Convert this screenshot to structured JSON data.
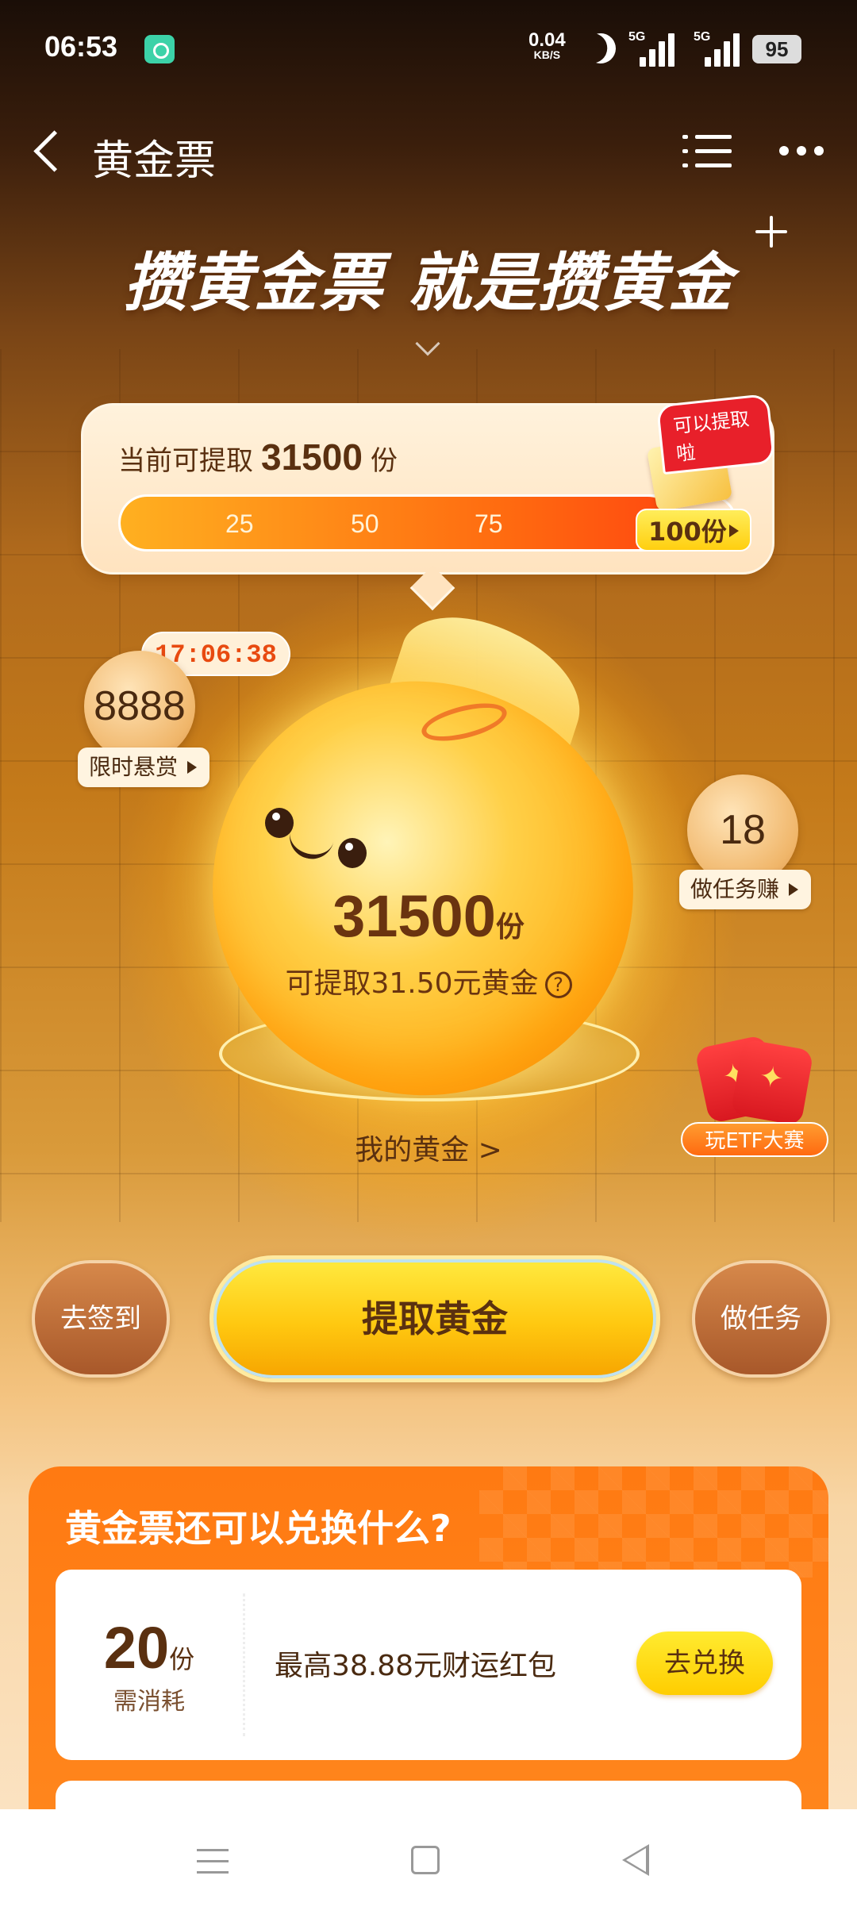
{
  "status_bar": {
    "time": "06:53",
    "net_speed": "0.04",
    "net_unit": "KB/S",
    "signal1": "5G",
    "signal2": "5G",
    "battery": "95"
  },
  "header": {
    "title": "黄金票"
  },
  "slogan": "攒黄金票 就是攒黄金",
  "progress": {
    "label_prefix": "当前可提取",
    "amount": "31500",
    "label_suffix": "份",
    "ticks": [
      "25",
      "50",
      "75"
    ],
    "target_label": "100份",
    "withdraw_tag": "可以提取啦",
    "fill_fraction": 0.9
  },
  "bag": {
    "amount": "31500",
    "unit": "份",
    "sub_text": "可提取31.50元黄金",
    "help_icon": "question-circle-icon",
    "my_gold": "我的黄金 >"
  },
  "limited": {
    "timer": "17:06:38",
    "value": "8888",
    "label": "限时悬赏"
  },
  "task_bubble": {
    "value": "18",
    "label": "做任务赚"
  },
  "etf": {
    "label": "玩ETF大赛"
  },
  "actions": {
    "signin": "去签到",
    "withdraw": "提取黄金",
    "task": "做任务"
  },
  "exchange": {
    "title": "黄金票还可以兑换什么?",
    "items": [
      {
        "cost": "20",
        "unit": "份",
        "cost_label": "需消耗",
        "description": "最高38.88元财运红包",
        "button": "去兑换"
      }
    ]
  },
  "colors": {
    "accent_orange": "#ff7a12",
    "gold_button": "#ffc810",
    "brown_text": "#5a3010"
  }
}
